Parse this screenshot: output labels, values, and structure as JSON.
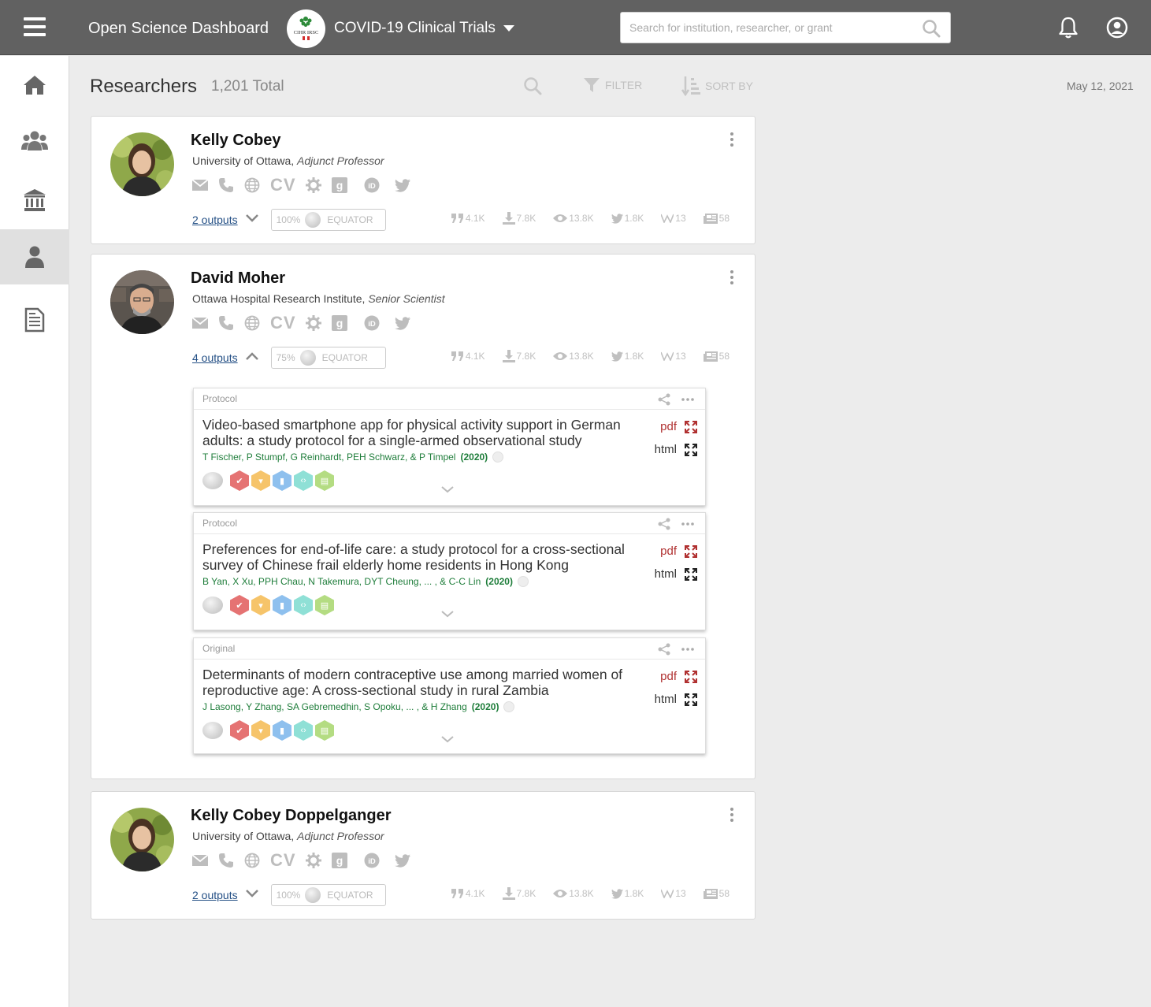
{
  "header": {
    "app_title": "Open Science Dashboard",
    "project": "COVID-19 Clinical Trials",
    "search_placeholder": "Search for institution, researcher, or grant",
    "logo_text": "CIHR IRSC"
  },
  "sidebar": {
    "items": [
      {
        "name": "home-icon",
        "active": false
      },
      {
        "name": "groups-icon",
        "active": false
      },
      {
        "name": "institution-icon",
        "active": false
      },
      {
        "name": "person-icon",
        "active": true
      },
      {
        "name": "document-icon",
        "active": false
      }
    ]
  },
  "page": {
    "title": "Researchers",
    "total": "1,201 Total",
    "filter_label": "FILTER",
    "sort_label": "SORT BY",
    "date": "May 12, 2021"
  },
  "researchers": [
    {
      "name": "Kelly Cobey",
      "institution": "University of Ottawa,",
      "position": "Adjunct Professor",
      "outputs_label": "2 outputs",
      "equator_pct": "100%",
      "equator_label": "EQUATOR",
      "metrics": {
        "citations": "4.1K",
        "downloads": "7.8K",
        "views": "13.8K",
        "tweets": "1.8K",
        "wiki": "13",
        "news": "58"
      }
    },
    {
      "name": "David Moher",
      "institution": "Ottawa Hospital Research Institute,",
      "position": "Senior Scientist",
      "outputs_label": "4 outputs",
      "equator_pct": "75%",
      "equator_label": "EQUATOR",
      "metrics": {
        "citations": "4.1K",
        "downloads": "7.8K",
        "views": "13.8K",
        "tweets": "1.8K",
        "wiki": "13",
        "news": "58"
      }
    },
    {
      "name": "Kelly Cobey Doppelganger",
      "institution": "University of Ottawa,",
      "position": "Adjunct Professor",
      "outputs_label": "2 outputs",
      "equator_pct": "100%",
      "equator_label": "EQUATOR",
      "metrics": {
        "citations": "4.1K",
        "downloads": "7.8K",
        "views": "13.8K",
        "tweets": "1.8K",
        "wiki": "13",
        "news": "58"
      }
    }
  ],
  "contact_labels": {
    "cv": "CV"
  },
  "outputs": [
    {
      "type": "Protocol",
      "title": "Video-based smartphone app for physical activity support in German adults: a study protocol for a single-armed observational study",
      "authors": "T Fischer, P Stumpf, G Reinhardt, PEH Schwarz, & P Timpel",
      "year": "(2020)",
      "pdf": "pdf",
      "html": "html"
    },
    {
      "type": "Protocol",
      "title": "Preferences for end-of-life care: a study protocol for a cross-sectional survey of Chinese frail elderly home residents in Hong Kong",
      "authors": "B Yan, X Xu, PPH Chau, N Takemura, DYT Cheung, ... , & C-C Lin",
      "year": "(2020)",
      "pdf": "pdf",
      "html": "html"
    },
    {
      "type": "Original",
      "title": "Determinants of modern contraceptive use among married women of reproductive age: A cross-sectional study in rural Zambia",
      "authors": "J Lasong, Y Zhang, SA Gebremedhin, S Opoku, ... , & H Zhang",
      "year": "(2020)",
      "pdf": "pdf",
      "html": "html"
    }
  ],
  "colors": {
    "topbar": "#616161",
    "badge_red": "#e57373",
    "badge_orange": "#f6c46a",
    "badge_blue": "#8ec0ee",
    "badge_teal": "#8fe0d6",
    "badge_green": "#b4dc82",
    "link": "#234f85",
    "authors": "#1e7d3a",
    "pdf": "#b03030"
  }
}
